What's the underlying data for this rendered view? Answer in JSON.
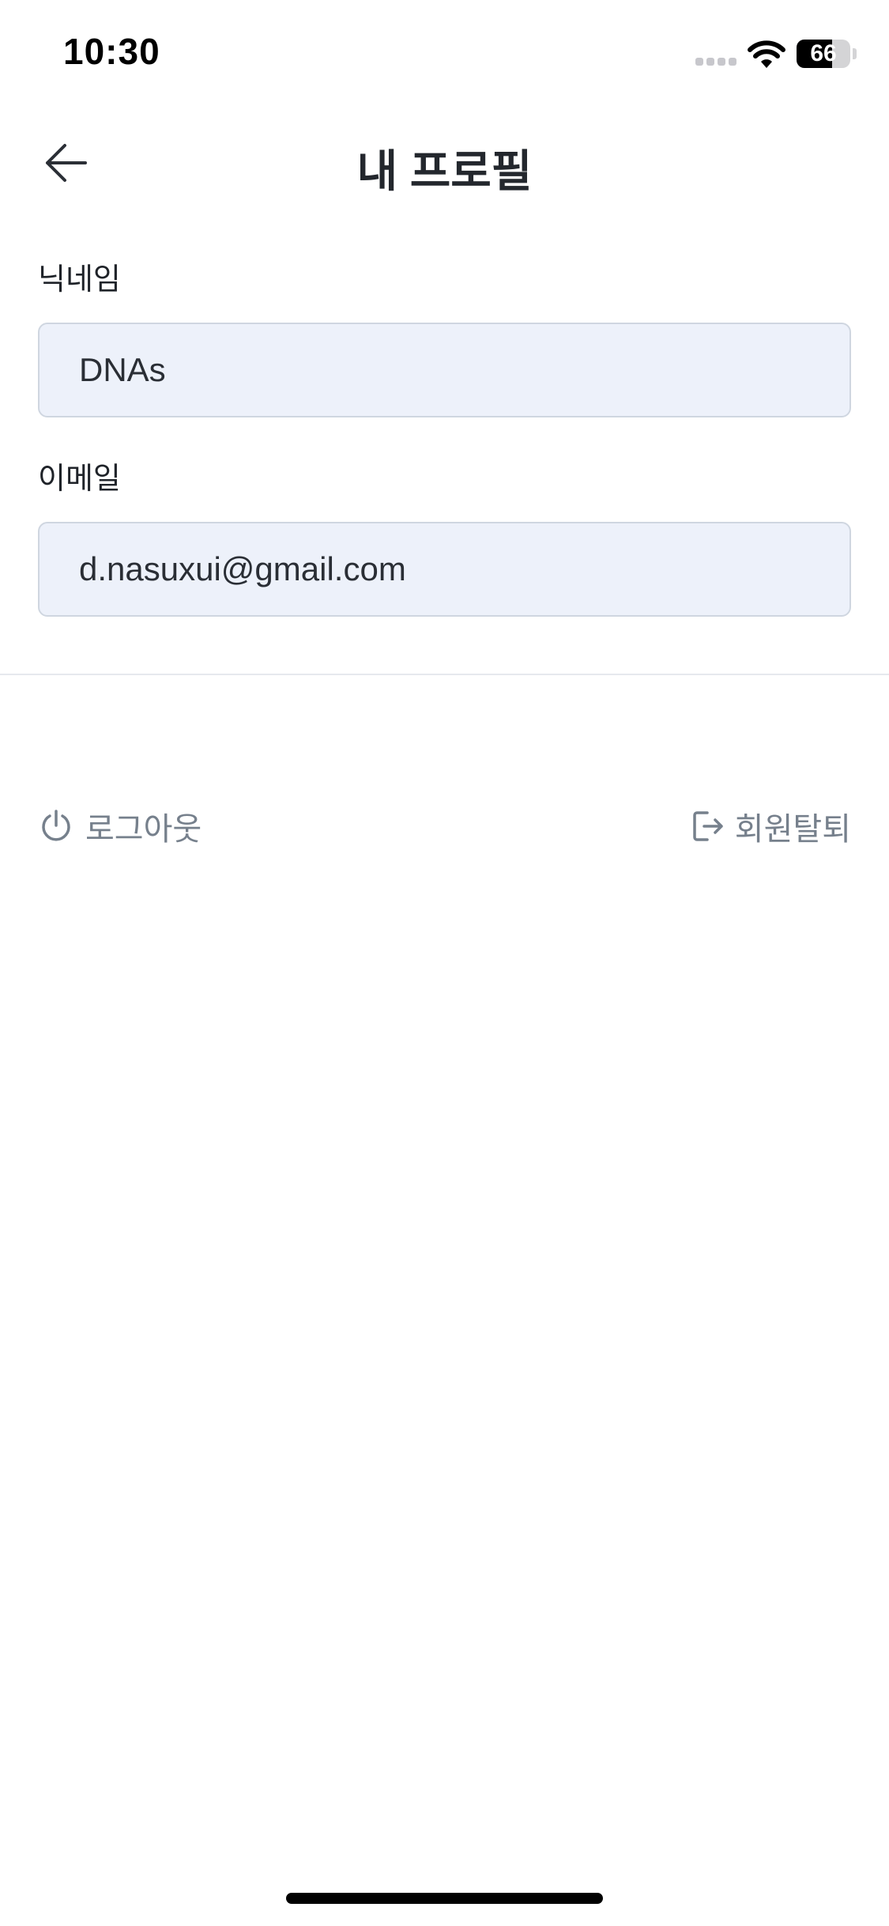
{
  "status_bar": {
    "time": "10:30",
    "battery_level": "66",
    "battery_fraction": 0.66,
    "icons": [
      "cellular-signal-icon",
      "wifi-icon",
      "battery-icon"
    ]
  },
  "header": {
    "title": "내 프로필",
    "back_icon": "arrow-left-icon"
  },
  "form": {
    "nickname": {
      "label": "닉네임",
      "value": "DNAs"
    },
    "email": {
      "label": "이메일",
      "value": "d.nasuxui@gmail.com"
    }
  },
  "actions": {
    "logout": {
      "label": "로그아웃",
      "icon": "power-icon"
    },
    "withdraw": {
      "label": "회원탈퇴",
      "icon": "exit-icon"
    }
  },
  "colors": {
    "field_background": "#edf1fa",
    "field_border": "#cfd6e0",
    "action_text": "#76808c",
    "title_text": "#23272d"
  }
}
